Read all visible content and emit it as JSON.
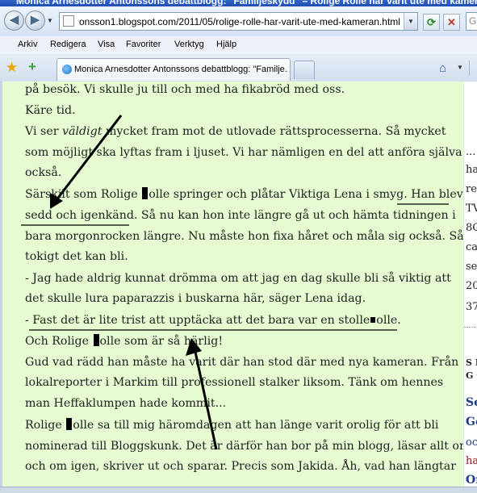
{
  "window": {
    "title": "Monica Arnesdotter Antonssons debattblogg: \"Familjeskydd\" – Rolige Rolle har varit ute med kameran"
  },
  "address_bar": {
    "url": "onsson1.blogspot.com/2011/05/rolige-rolle-har-varit-ute-med-kameran.html",
    "search_placeholder": "G"
  },
  "menu": {
    "items": [
      "Arkiv",
      "Redigera",
      "Visa",
      "Favoriter",
      "Verktyg",
      "Hjälp"
    ]
  },
  "tabs": {
    "active_label": "Monica Arnesdotter Antonssons debattblogg: \"Familje..."
  },
  "post": {
    "lines": {
      "l1": "på besök. Vi skulle ju till och med ha fikabröd med oss.",
      "l2": "Käre tid.",
      "l3a": "Vi ser ",
      "l3b": "väldigt",
      "l3c": " mycket fram mot de utlovade rättsprocesserna. Så mycket",
      "l4": "som möjligt ska lyftas fram i ljuset. Vi har  nämligen en del att anföra själva",
      "l5": "också.",
      "l6a": "Särskilt som Rolige ",
      "l6b": "olle springer och plåtar Viktiga Lena i smyg. Han blev",
      "l7": "sedd och igenkänd. Så nu kan hon inte längre gå ut och hämta tidningen i",
      "l8": "bara morgonrocken längre. Nu måste hon fixa håret och måla sig också. Så",
      "l9": "tokigt det kan bli.",
      "l10": "- Jag hade aldrig kunnat drömma om att jag en dag skulle bli så viktig att",
      "l11": "det skulle lura paparazzis i buskarna här, säger Lena idag.",
      "l12a": "- Fast det är lite trist att upptäcka att det bara var en stolle",
      "l12b": "olle.",
      "l13a": "Och Rolige ",
      "l13b": "olle som är så härlig!",
      "l14": "Gud vad rädd han måste ha varit där han stod där med nya kameran. Från",
      "l15": "lokalreporter i Markim till professionell stalker liksom. Tänk om hennes",
      "l16": "man Heffaklumpen hade kommit...",
      "l17a": "Rolige ",
      "l17b": "olle sa till mig häromdagen att han länge varit orolig för att bli",
      "l18": "nominerad till Bloggskunk. Det är därför han bor på min blogg, läsar allt om",
      "l19": "och om igen, skriver ut och sparar. Precis som Jakida. Åh, vad han längtar"
    }
  },
  "sidebar": {
    "s1": "...",
    "s2": "ha",
    "s3": "re",
    "s4": "TV",
    "s5": "8C",
    "s6": "ca",
    "s7": "se",
    "s8": "20",
    "s9": "37",
    "s10": "S E",
    "s11": "G Ö",
    "s12": "Se",
    "s13": "Gö",
    "s14": "oc",
    "s15": "ha",
    "s16": "Or"
  },
  "colors": {
    "page_background": "#e6fbd1",
    "sidebar_link": "#1a3a8c",
    "browser_chrome": "#dfe9f5"
  }
}
